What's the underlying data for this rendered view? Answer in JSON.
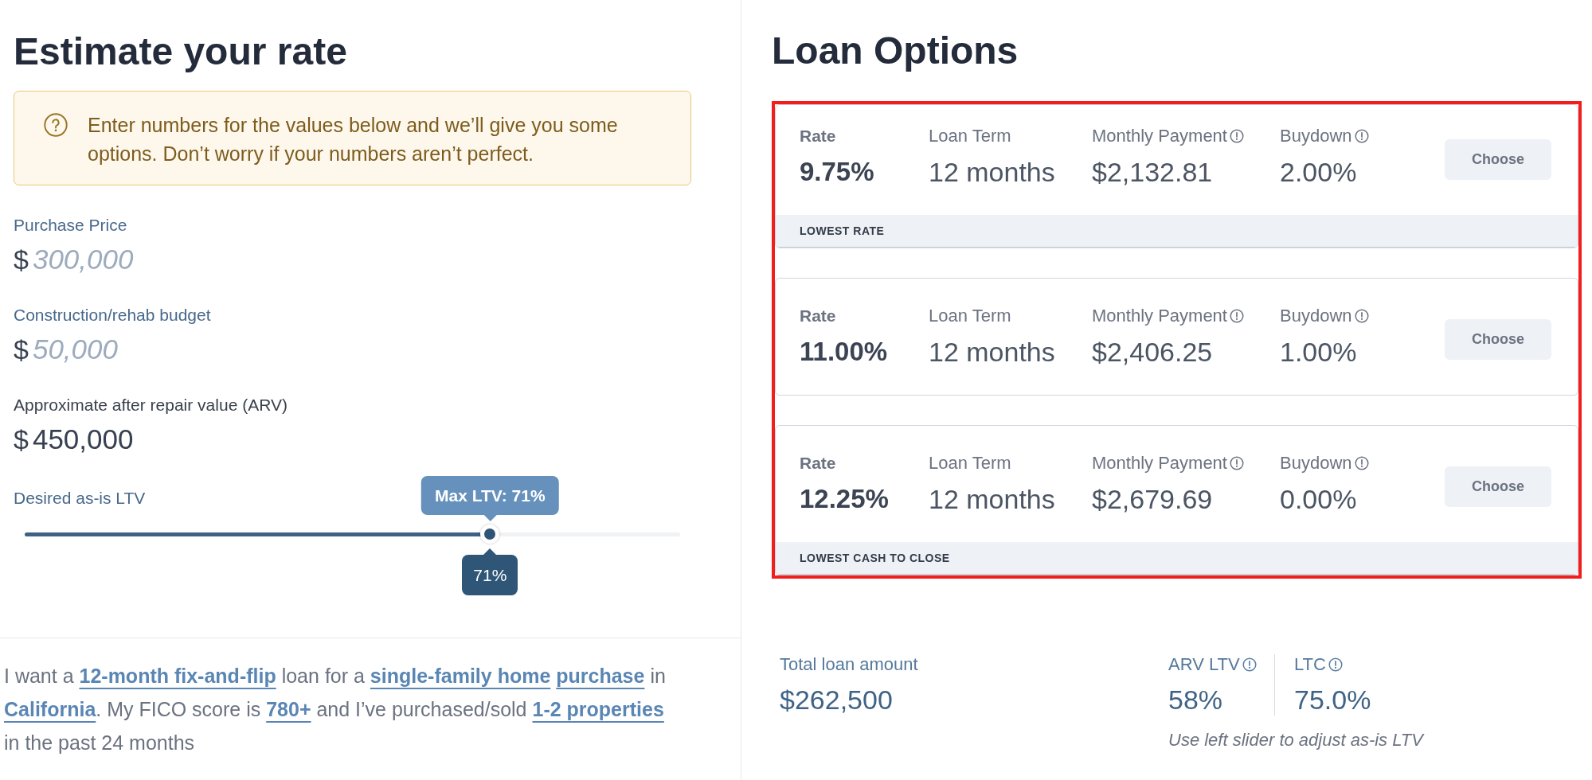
{
  "estimate": {
    "title": "Estimate your rate",
    "notice": "Enter numbers for the values below and we’ll give you some options. Don’t worry if your numbers aren’t perfect.",
    "fields": [
      {
        "label": "Purchase Price",
        "currency": "$",
        "placeholder": "300,000"
      },
      {
        "label": "Construction/rehab budget",
        "currency": "$",
        "placeholder": "50,000"
      },
      {
        "label": "Approximate after repair value (ARV)",
        "currency": "$",
        "value": "450,000"
      }
    ],
    "ltv_slider": {
      "label": "Desired as-is LTV",
      "max_tooltip": "Max LTV: 71%",
      "level": 0.71,
      "value_tooltip": "71%"
    },
    "summary": [
      {
        "kind": "text",
        "text": "I want a "
      },
      {
        "kind": "link",
        "text": "12-month fix-and-flip"
      },
      {
        "kind": "text",
        "text": " loan for a "
      },
      {
        "kind": "link",
        "text": "single-family home"
      },
      {
        "kind": "link",
        "text": "purchase"
      },
      {
        "kind": "text",
        "text": " in "
      },
      {
        "kind": "link",
        "text": "California"
      },
      {
        "kind": "text",
        "text": ". My FICO score is "
      },
      {
        "kind": "link",
        "text": "780+"
      },
      {
        "kind": "text",
        "text": " and I’ve purchased/sold "
      },
      {
        "kind": "link",
        "text": "1-2 properties"
      },
      {
        "kind": "text",
        "text": " in the past 24 months"
      }
    ]
  },
  "loan_options": {
    "title": "Loan Options",
    "highlighted": true,
    "options": [
      {
        "columns": [
          {
            "kind": "emphasis",
            "label": "Rate",
            "value": "9.75%"
          },
          {
            "kind": "plain",
            "label": "Loan Term",
            "value": "12 months"
          },
          {
            "kind": "info",
            "label": "Monthly Payment",
            "value": "$2,132.81"
          },
          {
            "kind": "info",
            "label": "Buydown",
            "value": "2.00%"
          }
        ],
        "button": "Choose",
        "tag": "LOWEST RATE"
      },
      {
        "columns": [
          {
            "kind": "emphasis",
            "label": "Rate",
            "value": "11.00%"
          },
          {
            "kind": "plain",
            "label": "Loan Term",
            "value": "12 months"
          },
          {
            "kind": "info",
            "label": "Monthly Payment",
            "value": "$2,406.25"
          },
          {
            "kind": "info",
            "label": "Buydown",
            "value": "1.00%"
          }
        ],
        "button": "Choose"
      },
      {
        "columns": [
          {
            "kind": "emphasis",
            "label": "Rate",
            "value": "12.25%"
          },
          {
            "kind": "plain",
            "label": "Loan Term",
            "value": "12 months"
          },
          {
            "kind": "info",
            "label": "Monthly Payment",
            "value": "$2,679.69"
          },
          {
            "kind": "info",
            "label": "Buydown",
            "value": "0.00%"
          }
        ],
        "button": "Choose",
        "tag": "LOWEST CASH TO CLOSE"
      }
    ],
    "totals": {
      "stats": [
        {
          "kind": "plain",
          "label": "Total loan amount",
          "value": "$262,500"
        },
        {
          "kind": "info",
          "label": "ARV LTV",
          "value": "58%"
        },
        {
          "kind": "info",
          "label": "LTC",
          "value": "75.0%"
        }
      ],
      "note": "Use left slider to adjust as-is LTV"
    }
  }
}
